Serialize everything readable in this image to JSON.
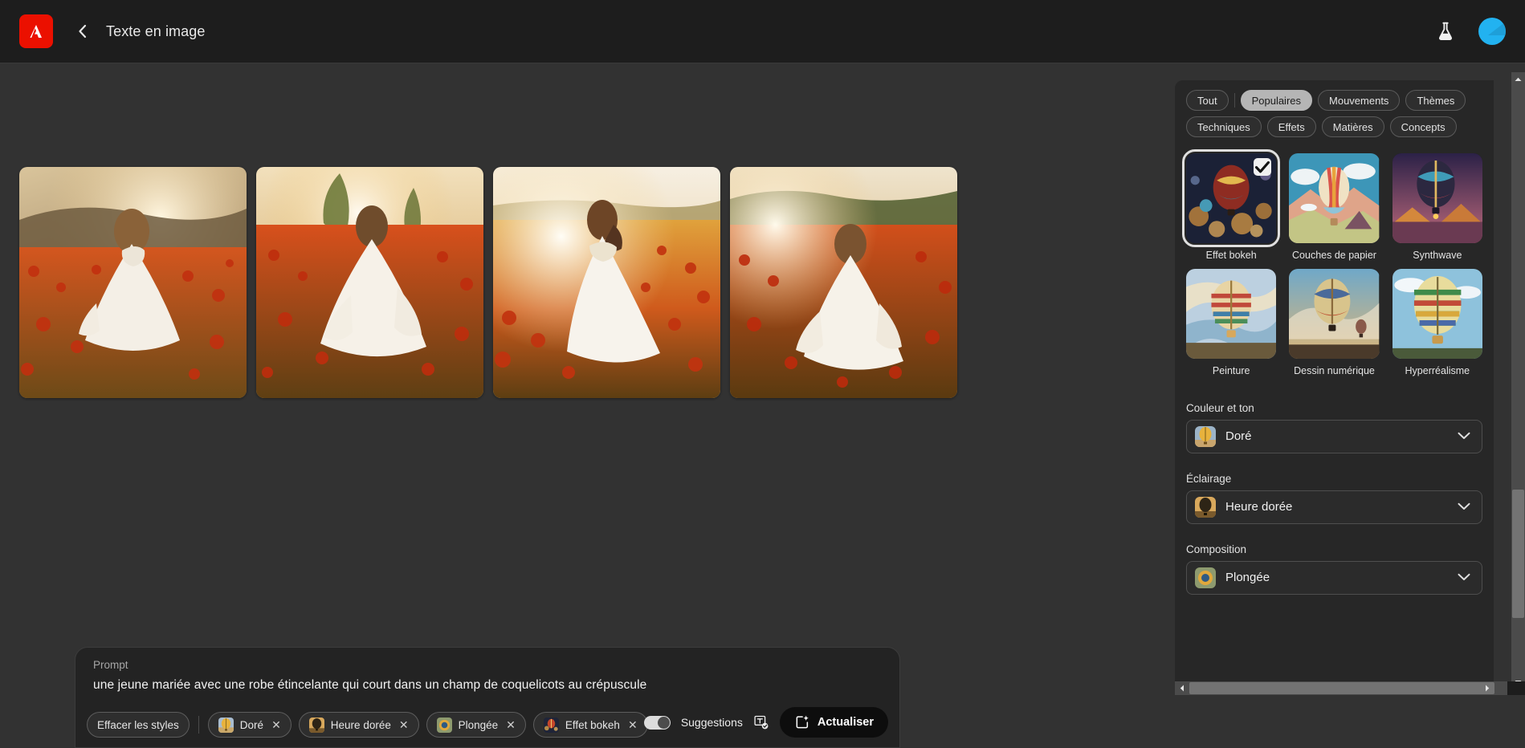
{
  "header": {
    "logo_icon": "adobe-logo-icon",
    "back_icon": "chevron-left-icon",
    "title": "Texte en image",
    "beaker_icon": "beaker-flask-icon",
    "avatar_icon": "user-avatar"
  },
  "results": {
    "tiles": [
      {
        "alt": "bride-running-poppy-field-1"
      },
      {
        "alt": "bride-running-poppy-field-2"
      },
      {
        "alt": "bride-running-poppy-field-3"
      },
      {
        "alt": "bride-running-poppy-field-4"
      }
    ]
  },
  "prompt": {
    "label": "Prompt",
    "text": "une jeune mariée avec une robe étincelante qui court dans un champ de coquelicots au crépuscule",
    "clear_styles_label": "Effacer les styles",
    "chips": [
      {
        "label": "Doré",
        "remove_icon": "close-icon"
      },
      {
        "label": "Heure dorée",
        "remove_icon": "close-icon"
      },
      {
        "label": "Plongée",
        "remove_icon": "close-icon"
      },
      {
        "label": "Effet bokeh",
        "remove_icon": "close-icon"
      }
    ],
    "suggestions_label": "Suggestions",
    "suggestions_enabled": false,
    "text_badge_icon": "text-check-icon",
    "refresh_label": "Actualiser",
    "refresh_icon": "sparkle-image-icon"
  },
  "panel": {
    "tabs_row1": [
      "Tout",
      "Populaires",
      "Mouvements",
      "Thèmes"
    ],
    "tabs_row2": [
      "Techniques",
      "Effets",
      "Matières",
      "Concepts"
    ],
    "active_tab": "Populaires",
    "styles": [
      {
        "name": "Effet bokeh",
        "selected": true
      },
      {
        "name": "Couches de papier",
        "selected": false
      },
      {
        "name": "Synthwave",
        "selected": false
      },
      {
        "name": "Peinture",
        "selected": false
      },
      {
        "name": "Dessin numérique",
        "selected": false
      },
      {
        "name": "Hyperréalisme",
        "selected": false
      }
    ],
    "sections": [
      {
        "title": "Couleur et ton",
        "value": "Doré",
        "chevron_icon": "chevron-down-icon"
      },
      {
        "title": "Éclairage",
        "value": "Heure dorée",
        "chevron_icon": "chevron-down-icon"
      },
      {
        "title": "Composition",
        "value": "Plongée",
        "chevron_icon": "chevron-down-icon"
      }
    ]
  },
  "colors": {
    "header_bg": "#1d1d1d",
    "canvas_bg": "#323232",
    "panel_bg": "#272727",
    "accent_red": "#eb1000",
    "avatar_blue": "#22b2f0"
  }
}
